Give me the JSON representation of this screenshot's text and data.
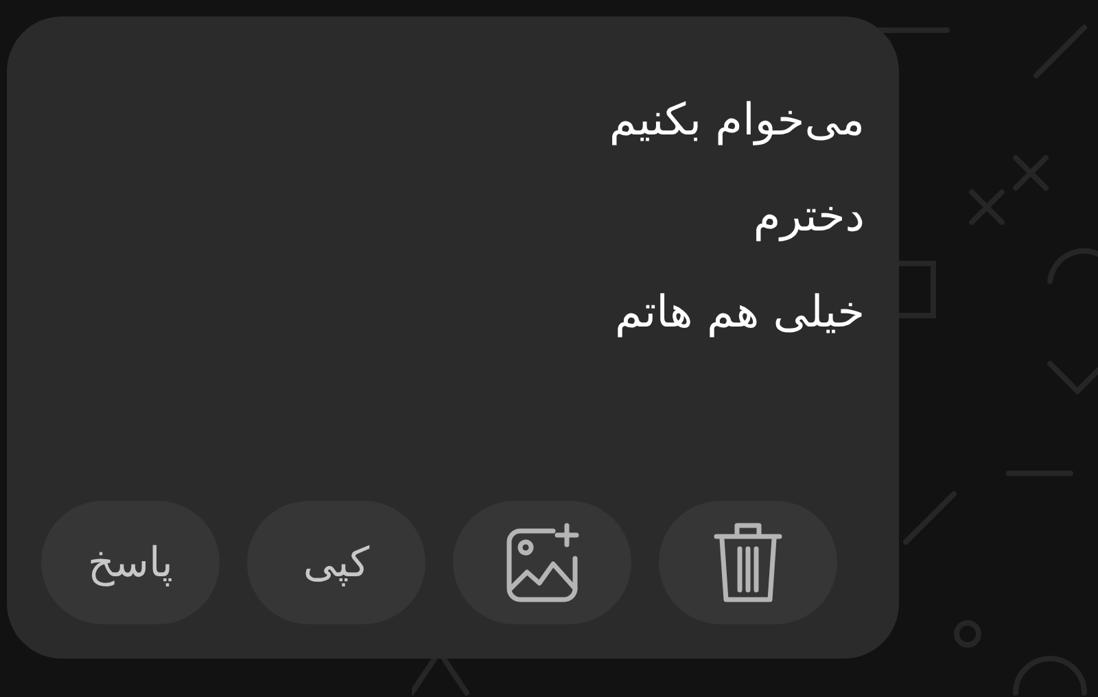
{
  "message": {
    "lines": [
      "می‌خوام بکنیم",
      "دخترم",
      "خیلی هم هاتم"
    ]
  },
  "actions": [
    {
      "kind": "delete"
    },
    {
      "kind": "add-image"
    },
    {
      "kind": "text",
      "label": "کپی"
    },
    {
      "kind": "text",
      "label": "پاسخ"
    }
  ]
}
